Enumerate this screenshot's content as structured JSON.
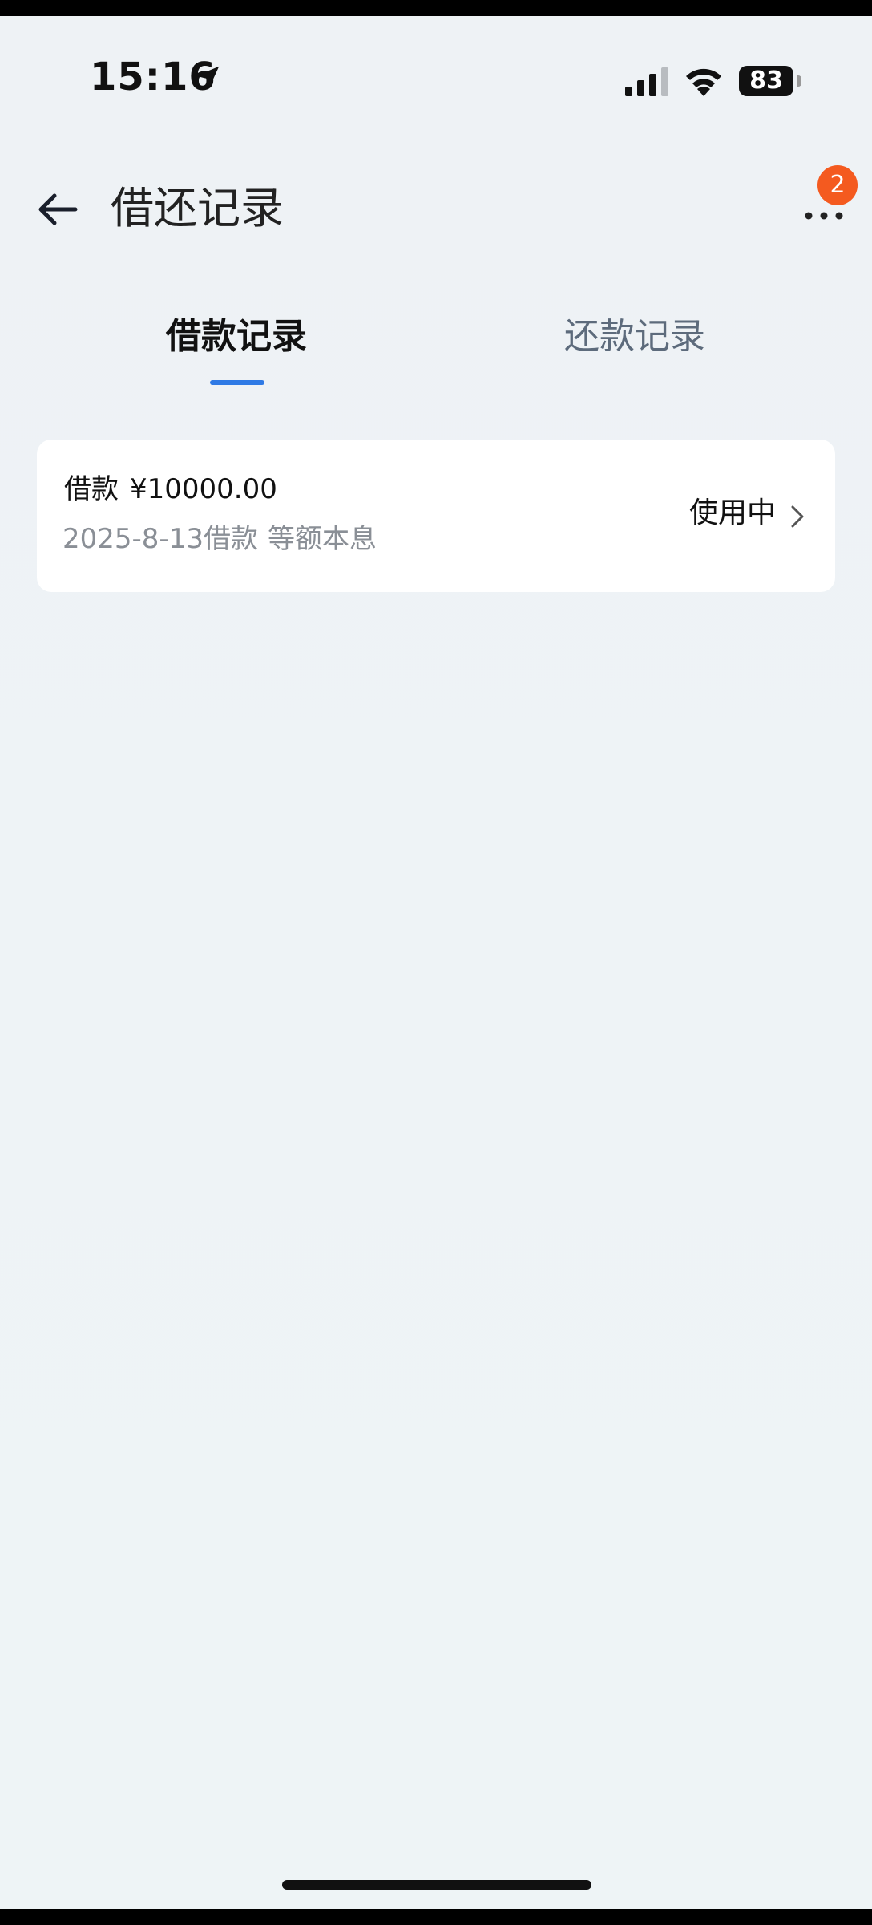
{
  "status_bar": {
    "time": "15:16",
    "location_icon": "location-arrow-icon",
    "signal_icon": "cellular-signal-icon",
    "wifi_icon": "wifi-icon",
    "battery_level": "83"
  },
  "header": {
    "title": "借还记录",
    "back_icon": "arrow-left-icon",
    "more_icon": "more-dots-icon",
    "badge_count": "2"
  },
  "tabs": [
    {
      "label": "借款记录",
      "active": true
    },
    {
      "label": "还款记录",
      "active": false
    }
  ],
  "records": [
    {
      "label": "借款",
      "amount": "¥10000.00",
      "date": "2025-8-13借款",
      "repayment_type": "等额本息",
      "status": "使用中"
    }
  ],
  "colors": {
    "accent": "#2f7ae5",
    "badge": "#f45a1f",
    "background": "#eef3f6",
    "card": "#ffffff",
    "secondary_text": "#8a8f96",
    "inactive_tab": "#5d6b7c"
  }
}
